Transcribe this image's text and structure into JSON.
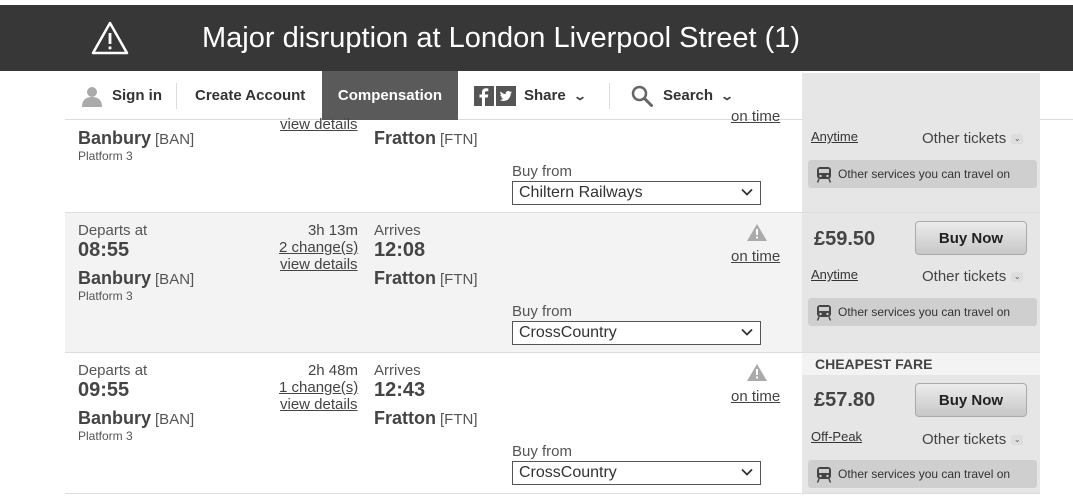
{
  "banner": {
    "title": "Major disruption at London Liverpool Street (1)"
  },
  "nav": {
    "sign_in": "Sign in",
    "create_account": "Create Account",
    "compensation": "Compensation",
    "share": "Share",
    "search": "Search"
  },
  "journeys": [
    {
      "dep_station": "Banbury",
      "dep_code": "[BAN]",
      "platform": "Platform 3",
      "view_details": "view details",
      "arr_station": "Fratton",
      "arr_code": "[FTN]",
      "status": "on time",
      "buy_from_label": "Buy from",
      "operator": "Chiltern Railways",
      "fare_type": "Anytime",
      "other_tickets": "Other tickets",
      "services": "Other services you can travel on"
    },
    {
      "dep_label": "Departs at",
      "dep_time": "08:55",
      "dep_station": "Banbury",
      "dep_code": "[BAN]",
      "platform": "Platform 3",
      "duration": "3h 13m",
      "changes": "2 change(s)",
      "view_details": "view details",
      "arr_label": "Arrives",
      "arr_time": "12:08",
      "arr_station": "Fratton",
      "arr_code": "[FTN]",
      "status": "on time",
      "buy_from_label": "Buy from",
      "operator": "CrossCountry",
      "price": "£59.50",
      "buy_now": "Buy Now",
      "fare_type": "Anytime",
      "other_tickets": "Other tickets",
      "services": "Other services you can travel on"
    },
    {
      "dep_label": "Departs at",
      "dep_time": "09:55",
      "dep_station": "Banbury",
      "dep_code": "[BAN]",
      "platform": "Platform 3",
      "duration": "2h 48m",
      "changes": "1 change(s)",
      "view_details": "view details",
      "arr_label": "Arrives",
      "arr_time": "12:43",
      "arr_station": "Fratton",
      "arr_code": "[FTN]",
      "status": "on time",
      "buy_from_label": "Buy from",
      "operator": "CrossCountry",
      "cheapest_label": "CHEAPEST FARE",
      "price": "£57.80",
      "buy_now": "Buy Now",
      "fare_type": "Off-Peak",
      "other_tickets": "Other tickets",
      "services": "Other services you can travel on"
    }
  ],
  "colors": {
    "banner_bg": "#373737",
    "compensation_bg": "#5a5a5a",
    "fare_panel_bg": "#e6e6e6"
  }
}
